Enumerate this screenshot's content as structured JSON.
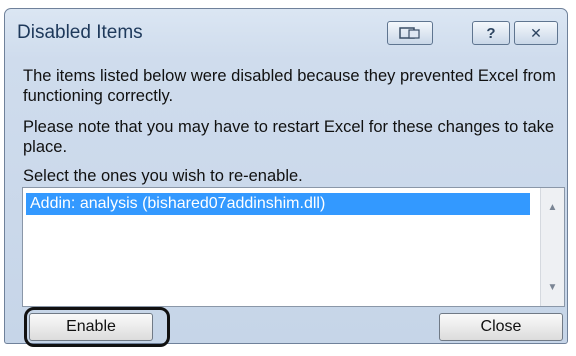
{
  "window": {
    "title": "Disabled Items"
  },
  "titlebar": {
    "restore_icon": "window-restore-icon",
    "help_label": "?",
    "close_label": "✕"
  },
  "message": {
    "line1": "The items listed below were disabled because they prevented Excel from functioning correctly.",
    "line2": "Please note that you may have to restart Excel for these changes to take place.",
    "line3": "Select the ones you wish to re-enable."
  },
  "list": {
    "items": [
      {
        "label": "Addin: analysis (bishared07addinshim.dll)",
        "selected": true
      }
    ]
  },
  "buttons": {
    "enable_label": "Enable",
    "close_label": "Close"
  },
  "colors": {
    "selection": "#3399ff",
    "frame": "#cfdced",
    "title_text": "#1e395b"
  }
}
